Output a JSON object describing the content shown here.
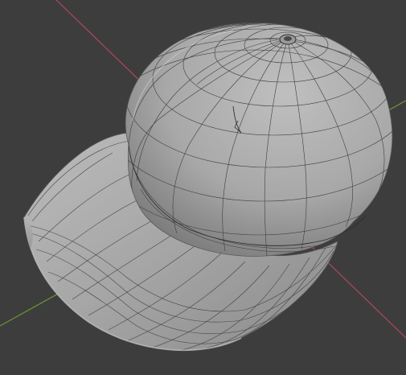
{
  "viewport": {
    "background": "#3d3d3d",
    "axis_colors": {
      "x_axis": "#b0485a",
      "y_axis": "#6c9a2e"
    },
    "mesh_fill": "#a6a6a6",
    "mesh_wire": "#3a3a3a"
  },
  "object": {
    "icon": "cap-mesh-icon",
    "mode": "wireframe-overlay"
  }
}
